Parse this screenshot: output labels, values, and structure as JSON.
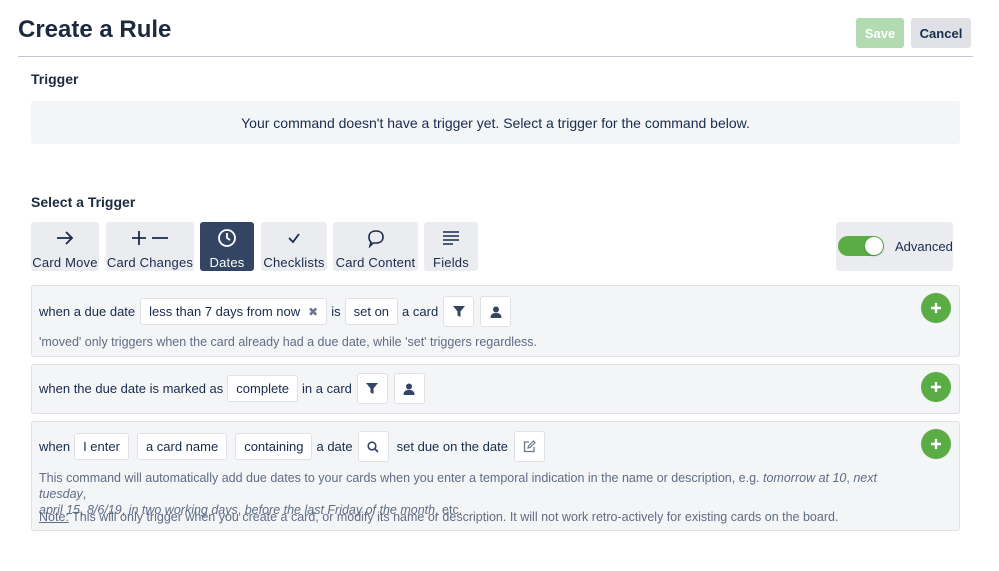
{
  "header": {
    "title": "Create a Rule",
    "save_label": "Save",
    "cancel_label": "Cancel"
  },
  "trigger_section": {
    "title": "Trigger",
    "empty_message": "Your command doesn't have a trigger yet. Select a trigger for the command below."
  },
  "select_section": {
    "title": "Select a Trigger",
    "tabs": [
      {
        "label": "Card Move",
        "icon": "arrow-right-icon"
      },
      {
        "label": "Card Changes",
        "icon": "plus-minus-icon"
      },
      {
        "label": "Dates",
        "icon": "clock-icon",
        "active": true
      },
      {
        "label": "Checklists",
        "icon": "checkmark-icon"
      },
      {
        "label": "Card Content",
        "icon": "comment-icon"
      },
      {
        "label": "Fields",
        "icon": "lines-icon"
      }
    ],
    "advanced_label": "Advanced",
    "advanced_on": true
  },
  "triggers": [
    {
      "pre": "when a due date",
      "range_value": "less than 7 days from now",
      "is_label": "is",
      "state_value": "set on",
      "post": "a card",
      "note": "'moved' only triggers when the card already had a due date, while 'set' triggers regardless."
    },
    {
      "pre": "when the due date is marked as",
      "state_value": "complete",
      "post": "in a card"
    },
    {
      "when_label": "when",
      "actor_value": "I enter",
      "field_value": "a card name",
      "match_value": "containing",
      "date_label": "a date",
      "action_label": "set due on the date",
      "desc_1": "This command will automatically add due dates to your cards when you enter a temporal indication in the name or description, e.g. ",
      "ex_1": "tomorrow at 10",
      "sep_1": ", ",
      "ex_2": "next tuesday",
      "sep_2": ",",
      "ex_3": "april 15",
      "sep_3": ", ",
      "ex_4": "8/6/19",
      "sep_4": ", ",
      "ex_5": "in two working days",
      "sep_5": ", ",
      "ex_6": "before the last Friday of the month",
      "desc_end": ", etc.",
      "note_label": "Note:",
      "note_text": " This will only trigger when you create a card, or modify its name or description. It will not work retro-actively for existing cards on the board."
    }
  ],
  "colors": {
    "accent_green": "#5aac44",
    "active_tab": "#344563",
    "panel_bg": "#f4f5f7"
  }
}
